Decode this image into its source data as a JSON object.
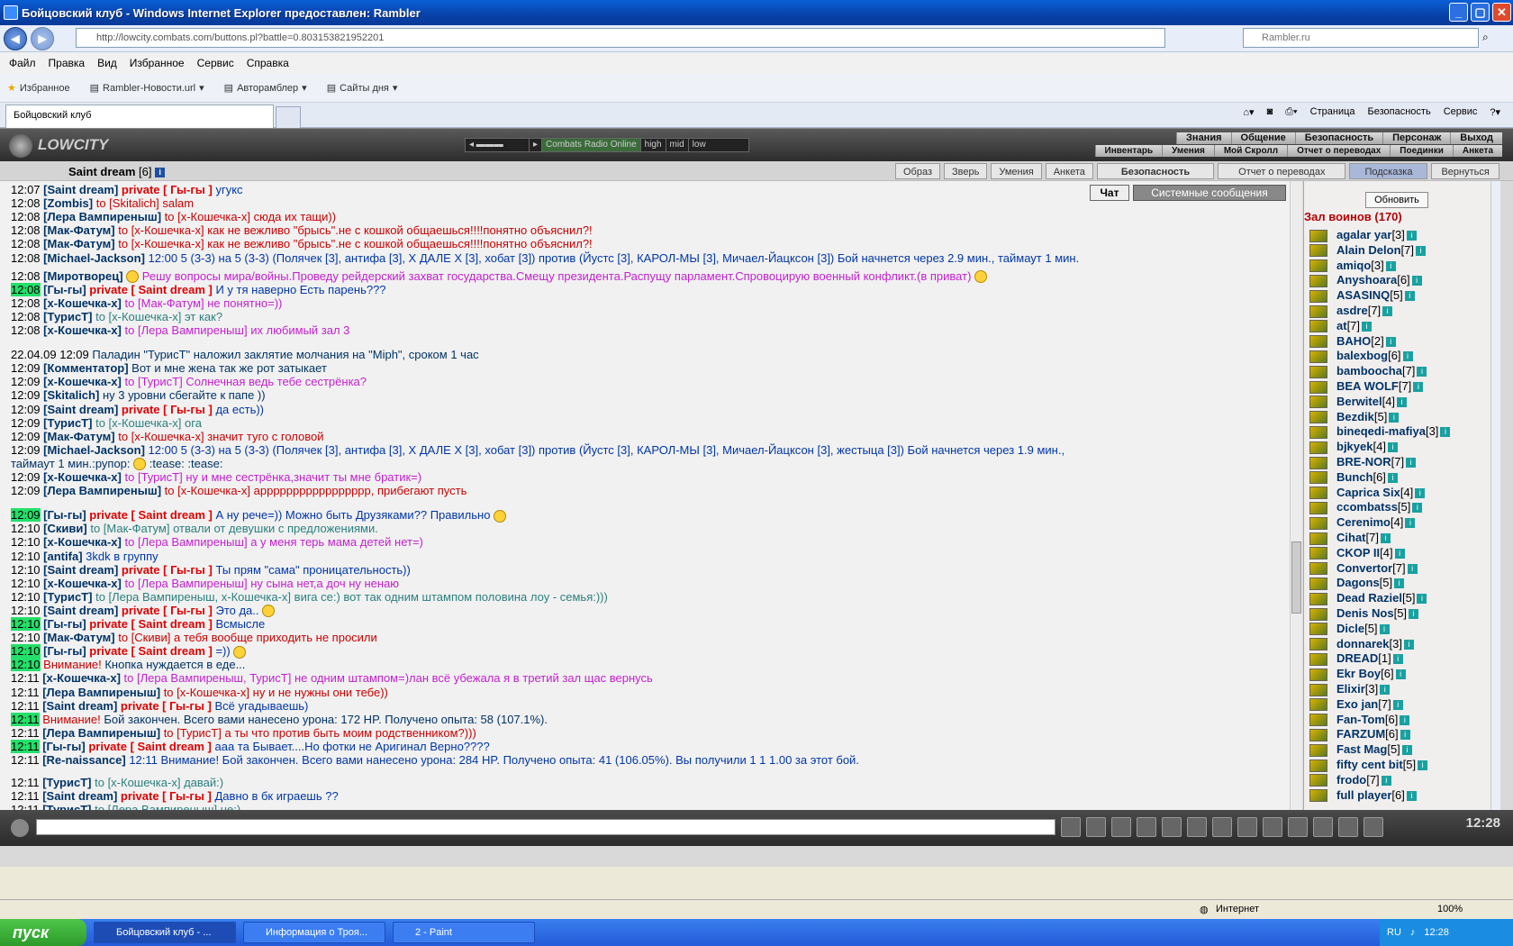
{
  "window": {
    "title": "Бойцовский клуб - Windows Internet Explorer предоставлен: Rambler"
  },
  "nav": {
    "url": "http://lowcity.combats.com/buttons.pl?battle=0.803153821952201",
    "search_placeholder": "Rambler.ru"
  },
  "menu": [
    "Файл",
    "Правка",
    "Вид",
    "Избранное",
    "Сервис",
    "Справка"
  ],
  "favorites": {
    "label": "Избранное",
    "links": [
      "Rambler-Новости.url",
      "Авторамблер",
      "Сайты дня"
    ]
  },
  "tabs": {
    "active": "Бойцовский клуб"
  },
  "commandbar": [
    "Страница",
    "Безопасность",
    "Сервис"
  ],
  "game": {
    "logo": "LOWCITY",
    "radio": {
      "label": "Combats Radio Online",
      "q1": "high",
      "q2": "mid",
      "q3": "low"
    },
    "topnav": [
      "Знания",
      "Общение",
      "Безопасность",
      "Персонаж",
      "Выход"
    ],
    "subnav": [
      "Инвентарь",
      "Умения",
      "Мой Скролл",
      "Отчет о переводах",
      "Поединки",
      "Анкета"
    ],
    "user": {
      "name": "Saint dream",
      "level": "[6]"
    },
    "ptabs": [
      "Образ",
      "Зверь",
      "Умения",
      "Анкета",
      "Безопасность",
      "Отчет о переводах",
      "Подсказка",
      "Вернуться"
    ],
    "chat_tabs": [
      "Чат",
      "Системные сообщения"
    ]
  },
  "chat": [
    {
      "t": "12:07",
      "n": "Saint dream",
      "p": "private [ Гы-гы ]",
      "m": "угукс"
    },
    {
      "t": "12:08",
      "n": "Zombis",
      "to": "to [Skitalich]",
      "m": "salam"
    },
    {
      "t": "12:08",
      "n": "Лера Вампиреныш",
      "to": "to [x-Кошечка-x]",
      "m": "сюда их тащи))"
    },
    {
      "t": "12:08",
      "n": "Мак-Фатум",
      "to": "to [x-Кошечка-x]",
      "m": "как не вежливо \"брысь\".не с кошкой общаешься!!!!понятно объяснил?!"
    },
    {
      "t": "12:08",
      "n": "Мак-Фатум",
      "to": "to [x-Кошечка-x]",
      "m": "как не вежливо \"брысь\".не с кошкой общаешься!!!!понятно объяснил?!"
    },
    {
      "t": "12:08",
      "n": "Michael-Jackson",
      "m": "12:00 5 (3-3) на 5 (3-3) (Полячек [3], антифа [3], X ДАЛЕ X [3], хобат [3]) против (Йустс [3], КАРОЛ-МЫ [3], Мичаел-Йацксон [3]) Бой начнется через 2.9 мин., таймаут 1 мин."
    },
    {
      "t": "12:08",
      "n": "Миротворец",
      "m": "Решу вопросы мира/войны.Проведу рейдерский захват государства.Смещу президента.Распущу парламент.Спровоцирую военный конфликт.(в приват)"
    },
    {
      "t": "12:08",
      "n": "Гы-гы",
      "p": "private [ Saint dream ]",
      "m": "И у тя наверно Есть парень???"
    },
    {
      "t": "12:08",
      "n": "x-Кошечка-x",
      "to": "to [Мак-Фатум]",
      "m": "не понятно=))"
    },
    {
      "t": "12:08",
      "n": "ТурисТ",
      "to": "to [x-Кошечка-x]",
      "m": "эт как?"
    },
    {
      "t": "12:08",
      "n": "x-Кошечка-x",
      "to": "to [Лера Вампиреныш]",
      "m": "их любимый зал 3"
    },
    {
      "t": "22.04.09 12:09",
      "m": "Паладин \"ТурисТ\" наложил заклятие молчания на \"Miph\", сроком 1 час"
    },
    {
      "t": "12:09",
      "n": "Комментатор",
      "m": "Вот и мне жена так же рот затыкает"
    },
    {
      "t": "12:09",
      "n": "x-Кошечка-x",
      "to": "to [ТурисТ]",
      "m": "Солнечная ведь тебе сестрёнка?"
    },
    {
      "t": "12:09",
      "n": "Skitalich",
      "m": "ну 3 уровни сбегайте к папе ))"
    },
    {
      "t": "12:09",
      "n": "Saint dream",
      "p": "private [ Гы-гы ]",
      "m": "да есть))"
    },
    {
      "t": "12:09",
      "n": "ТурисТ",
      "to": "to [x-Кошечка-x]",
      "m": "ога"
    },
    {
      "t": "12:09",
      "n": "Мак-Фатум",
      "to": "to [x-Кошечка-x]",
      "m": "значит туго с головой"
    },
    {
      "t": "12:09",
      "n": "Michael-Jackson",
      "m": "12:00 5 (3-3) на 5 (3-3) (Полячек [3], антифа [3], X ДАЛЕ X [3], хобат [3]) против (Йустс [3], КАРОЛ-МЫ [3], Мичаел-Йацксон [3], жестыца [3]) Бой начнется через 1.9 мин.,"
    },
    {
      "t": "",
      "m": "таймаут 1 мин.:рупор:",
      "m2": ":tease: :tease:"
    },
    {
      "t": "12:09",
      "n": "x-Кошечка-x",
      "to": "to [ТурисТ]",
      "m": "ну и мне сестрёнка,значит ты мне братик=)"
    },
    {
      "t": "12:09",
      "n": "Лера Вампиреныш",
      "to": "to [x-Кошечка-x]",
      "m": "аррррррррррррррррр, прибегают пусть"
    },
    {
      "t": "12:09",
      "n": "Гы-гы",
      "p": "private [ Saint dream ]",
      "m": "А ну рече=)) Можно быть Друзяками?? Правильно"
    },
    {
      "t": "12:10",
      "n": "Скиви",
      "to": "to [Мак-Фатум]",
      "m": "отвали от девушки с предложениями."
    },
    {
      "t": "12:10",
      "n": "x-Кошечка-x",
      "to": "to [Лера Вампиреныш]",
      "m": "а у меня терь мама детей нет=)"
    },
    {
      "t": "12:10",
      "n": "antifa",
      "m": "3kdk в группу"
    },
    {
      "t": "12:10",
      "n": "Saint dream",
      "p": "private [ Гы-гы ]",
      "m": "Ты прям \"сама\" проницательность))"
    },
    {
      "t": "12:10",
      "n": "x-Кошечка-x",
      "to": "to [Лера Вампиреныш]",
      "m": "ну сына нет,а доч ну ненаю"
    },
    {
      "t": "12:10",
      "n": "ТурисТ",
      "to": "to [Лера Вампиреныш, x-Кошечка-x]",
      "m": "вига се:) вот так одним штампом половина лоу - семья:)))"
    },
    {
      "t": "12:10",
      "n": "Saint dream",
      "p": "private [ Гы-гы ]",
      "m": "Это да.."
    },
    {
      "t": "12:10",
      "n": "Гы-гы",
      "p": "private [ Saint dream ]",
      "m": "Всмысле"
    },
    {
      "t": "12:10",
      "n": "Мак-Фатум",
      "to": "to [Скиви]",
      "m": "а тебя вообще приходить не просили"
    },
    {
      "t": "12:10",
      "n": "Гы-гы",
      "p": "private [ Saint dream ]",
      "m": "=))"
    },
    {
      "t": "12:10",
      "w": "Внимание!",
      "m": "Кнопка нуждается в еде..."
    },
    {
      "t": "12:11",
      "n": "x-Кошечка-x",
      "to": "to [Лера Вампиреныш, ТурисТ]",
      "m": "не одним штампом=)лан всё убежала я в третий зал щас вернусь"
    },
    {
      "t": "12:11",
      "n": "Лера Вампиреныш",
      "to": "to [x-Кошечка-x]",
      "m": "ну и не нужны они тебе))"
    },
    {
      "t": "12:11",
      "n": "Saint dream",
      "p": "private [ Гы-гы ]",
      "m": "Всё угадываешь)"
    },
    {
      "t": "12:11",
      "w": "Внимание!",
      "m": "Бой закончен. Всего вами нанесено урона: 172 HP. Получено опыта: 58 (107.1%)."
    },
    {
      "t": "12:11",
      "n": "Лера Вампиреныш",
      "to": "to [ТурисТ]",
      "m": "а ты что против быть моим родственником?)))"
    },
    {
      "t": "12:11",
      "n": "Гы-гы",
      "p": "private [ Saint dream ]",
      "m": "ааа та Бывает....Но фотки не Аригинал Верно????"
    },
    {
      "t": "12:11",
      "n": "Re-naissance",
      "m": "12:11 Внимание! Бой закончен. Всего вами нанесено урона: 284 HP. Получено опыта: 41 (106.05%). Вы получили 1 1 1.00 за этот бой."
    },
    {
      "t": "12:11",
      "n": "ТурисТ",
      "to": "to [x-Кошечка-x]",
      "m": "давай:)"
    },
    {
      "t": "12:11",
      "n": "Saint dream",
      "p": "private [ Гы-гы ]",
      "m": "Давно в бк играешь ??"
    },
    {
      "t": "12:11",
      "n": "ТурисТ",
      "to": "to [Лера Вампиреныш]",
      "m": "не:)"
    }
  ],
  "room": {
    "refresh": "Обновить",
    "title": "Зал воинов (170)",
    "players": [
      {
        "n": "agalar yar",
        "l": "[3]"
      },
      {
        "n": "Alain Delon",
        "l": "[7]"
      },
      {
        "n": "amiqo",
        "l": "[3]"
      },
      {
        "n": "Anyshoara",
        "l": "[6]"
      },
      {
        "n": "ASASINQ",
        "l": "[5]"
      },
      {
        "n": "asdre",
        "l": "[7]"
      },
      {
        "n": "at",
        "l": "[7]"
      },
      {
        "n": "BAHO",
        "l": "[2]"
      },
      {
        "n": "balexbog",
        "l": "[6]"
      },
      {
        "n": "bamboocha",
        "l": "[7]"
      },
      {
        "n": "BEA WOLF",
        "l": "[7]"
      },
      {
        "n": "Berwitel",
        "l": "[4]"
      },
      {
        "n": "Bezdik",
        "l": "[5]"
      },
      {
        "n": "bineqedi-mafiya",
        "l": "[3]"
      },
      {
        "n": "bjkyek",
        "l": "[4]"
      },
      {
        "n": "BRE-NOR",
        "l": "[7]"
      },
      {
        "n": "Bunch",
        "l": "[6]"
      },
      {
        "n": "Caprica Six",
        "l": "[4]"
      },
      {
        "n": "ccombatss",
        "l": "[5]"
      },
      {
        "n": "Cerenimo",
        "l": "[4]"
      },
      {
        "n": "Cihat",
        "l": "[7]"
      },
      {
        "n": "CKOP II",
        "l": "[4]"
      },
      {
        "n": "Convertor",
        "l": "[7]"
      },
      {
        "n": "Dagons",
        "l": "[5]"
      },
      {
        "n": "Dead Raziel",
        "l": "[5]"
      },
      {
        "n": "Denis Nos",
        "l": "[5]"
      },
      {
        "n": "Dicle",
        "l": "[5]"
      },
      {
        "n": "donnarek",
        "l": "[3]"
      },
      {
        "n": "DREAD",
        "l": "[1]"
      },
      {
        "n": "Ekr Boy",
        "l": "[6]"
      },
      {
        "n": "Elixir",
        "l": "[3]"
      },
      {
        "n": "Exo jan",
        "l": "[7]"
      },
      {
        "n": "Fan-Tom",
        "l": "[6]"
      },
      {
        "n": "FARZUM",
        "l": "[6]"
      },
      {
        "n": "Fast Mag",
        "l": "[5]"
      },
      {
        "n": "fifty cent bit",
        "l": "[5]"
      },
      {
        "n": "frodo",
        "l": "[7]"
      },
      {
        "n": "full player",
        "l": "[6]"
      }
    ]
  },
  "clock": "12:28",
  "status": {
    "zone": "Интернет",
    "zoom": "100%"
  },
  "taskbar": {
    "start": "пуск",
    "tasks": [
      "Бойцовский клуб - ...",
      "Информация о Троя...",
      "2 - Paint"
    ],
    "lang": "RU",
    "time": "12:28"
  }
}
